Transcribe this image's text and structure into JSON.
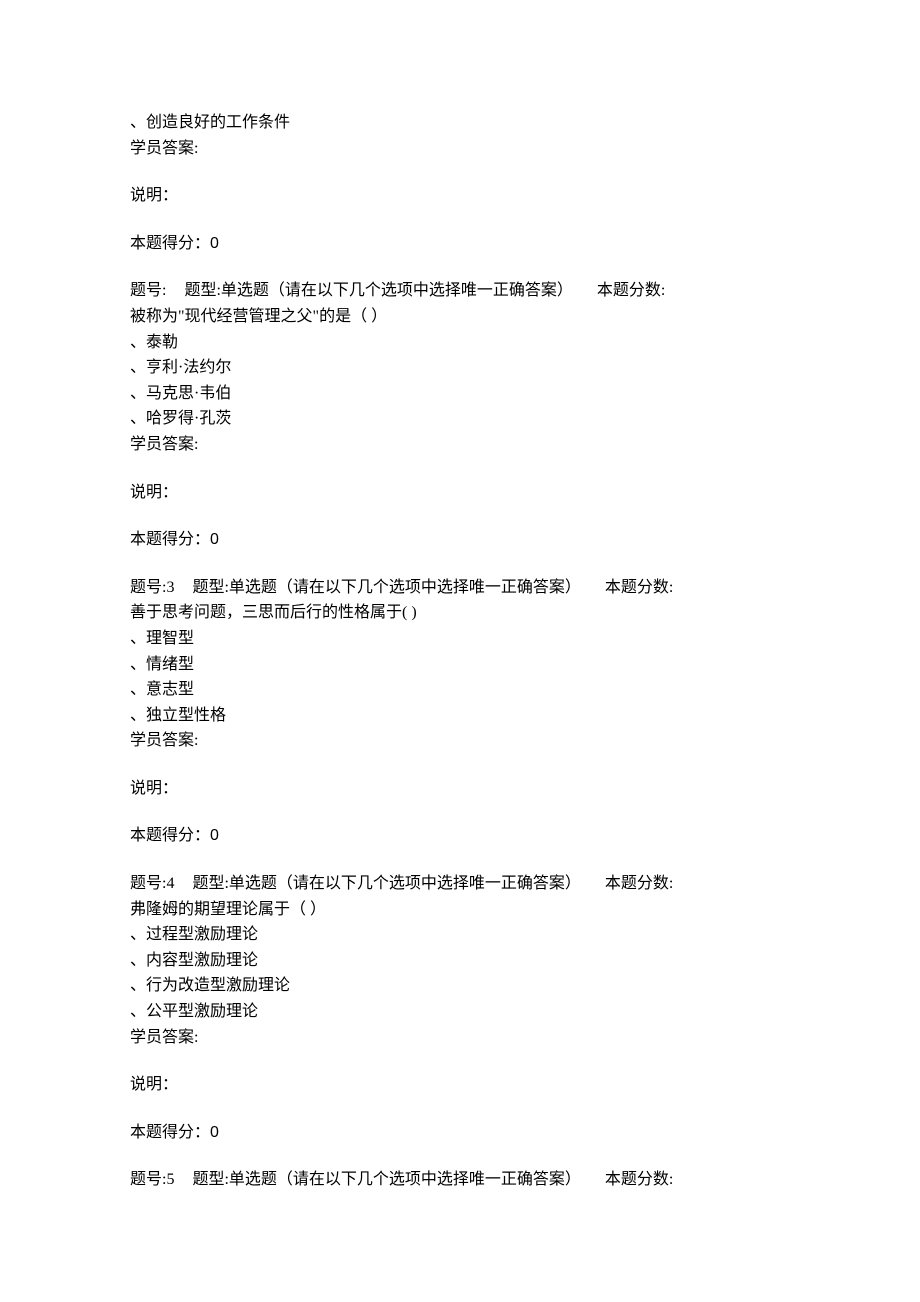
{
  "labels": {
    "student_answer": "学员答案:",
    "explain": "说明：",
    "score_prefix": "本题得分：",
    "qnum_prefix": "题号:",
    "type_prefix": "题型:单选题（请在以下几个选项中选择唯一正确答案）",
    "points_prefix": "本题分数:"
  },
  "q1_partial": {
    "opt_d": "、创造良好的工作条件",
    "score": "0"
  },
  "questions": [
    {
      "num": "",
      "stem": "被称为\"现代经营管理之父\"的是（ ）",
      "opts": [
        "、泰勒",
        "、亨利·法约尔",
        "、马克思·韦伯",
        "、哈罗得·孔茨"
      ],
      "score": "0"
    },
    {
      "num": "3",
      "stem": "善于思考问题，三思而后行的性格属于( )",
      "opts": [
        "、理智型",
        "、情绪型",
        "、意志型",
        "、独立型性格"
      ],
      "score": "0"
    },
    {
      "num": "4",
      "stem": "弗隆姆的期望理论属于（ ）",
      "opts": [
        "、过程型激励理论",
        "、内容型激励理论",
        "、行为改造型激励理论",
        "、公平型激励理论"
      ],
      "score": "0"
    },
    {
      "num": "5",
      "stem": "",
      "opts": [],
      "score": ""
    }
  ]
}
